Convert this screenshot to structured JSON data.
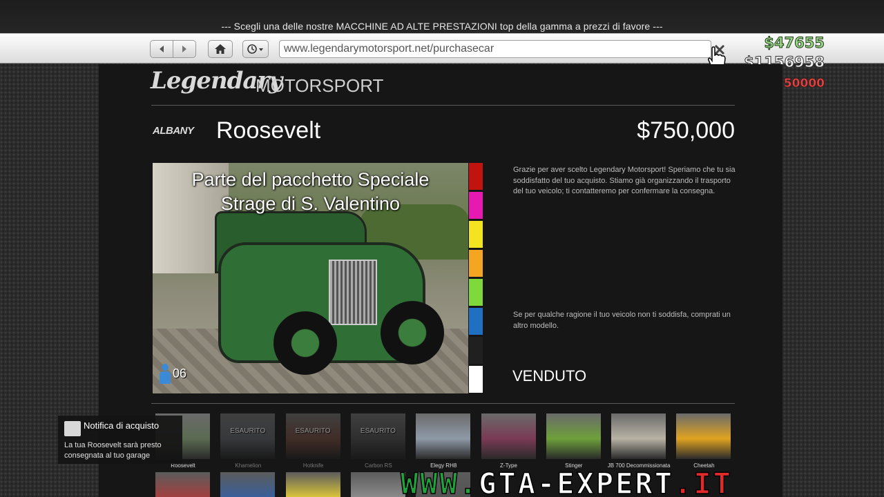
{
  "header": {
    "tagline": "--- Scegli una delle nostre MACCHINE AD ALTE PRESTAZIONI top della gamma a prezzi di favore ---"
  },
  "browser": {
    "url": "www.legendarymotorsport.net/purchasecar",
    "back_icon": "back-arrow-icon",
    "forward_icon": "forward-arrow-icon",
    "home_icon": "home-icon",
    "history_icon": "clock-history-icon",
    "close_icon": "close-x-icon"
  },
  "hud": {
    "cash": "$47655",
    "bank": "$1156958",
    "change": "-$750000"
  },
  "site": {
    "logo_script": "Legendary",
    "logo_text": "MOTORSPORT"
  },
  "vehicle": {
    "brand": "ALBANY",
    "name": "Roosevelt",
    "price": "$750,000",
    "banner_line1": "Parte del pacchetto Speciale",
    "banner_line2": "Strage di S. Valentino",
    "seats": "06",
    "colors": [
      "#c2140f",
      "#e61ab0",
      "#f3e41f",
      "#f4a521",
      "#7fd93a",
      "#1f6fc2",
      "#202020",
      "#ffffff"
    ],
    "thanks_text": "Grazie per aver scelto Legendary Motorsport! Speriamo che tu sia soddisfatto del tuo acquisto. Stiamo già organizzando il trasporto del tuo veicolo; ti contatteremo per confermare la consegna.",
    "unhappy_text": "Se per qualche ragione il tuo veicolo non ti soddisfa, comprati un altro modello.",
    "status": "VENDUTO"
  },
  "gallery": [
    {
      "label": "Roosevelt",
      "sold_out": "",
      "color": "#5b6b52"
    },
    {
      "label": "Khamelion",
      "sold_out": "ESAURITO",
      "color": "#5a5e63"
    },
    {
      "label": "Hotknife",
      "sold_out": "ESAURITO",
      "color": "#6b4a40"
    },
    {
      "label": "Carbon RS",
      "sold_out": "ESAURITO",
      "color": "#4d4d4d"
    },
    {
      "label": "Elegy RH8",
      "sold_out": "",
      "color": "#8f9aa8"
    },
    {
      "label": "Z-Type",
      "sold_out": "",
      "color": "#7a3a55"
    },
    {
      "label": "Stinger",
      "sold_out": "",
      "color": "#6ea03b"
    },
    {
      "label": "JB 700 Decommissionata",
      "sold_out": "",
      "color": "#b9b3a5"
    },
    {
      "label": "Cheetah",
      "sold_out": "",
      "color": "#e0a321"
    }
  ],
  "gallery_row2_colors": [
    "#a34040",
    "#3a5f9a",
    "#d9c43a",
    "#8a8a8a",
    "#555"
  ],
  "notification": {
    "title": "Notifica di acquisto",
    "body": "La tua Roosevelt sarà presto consegnata al tuo garage"
  },
  "watermark": {
    "part1": "WWW.",
    "part2": "GTA-EXPERT",
    "part3": ".IT"
  }
}
